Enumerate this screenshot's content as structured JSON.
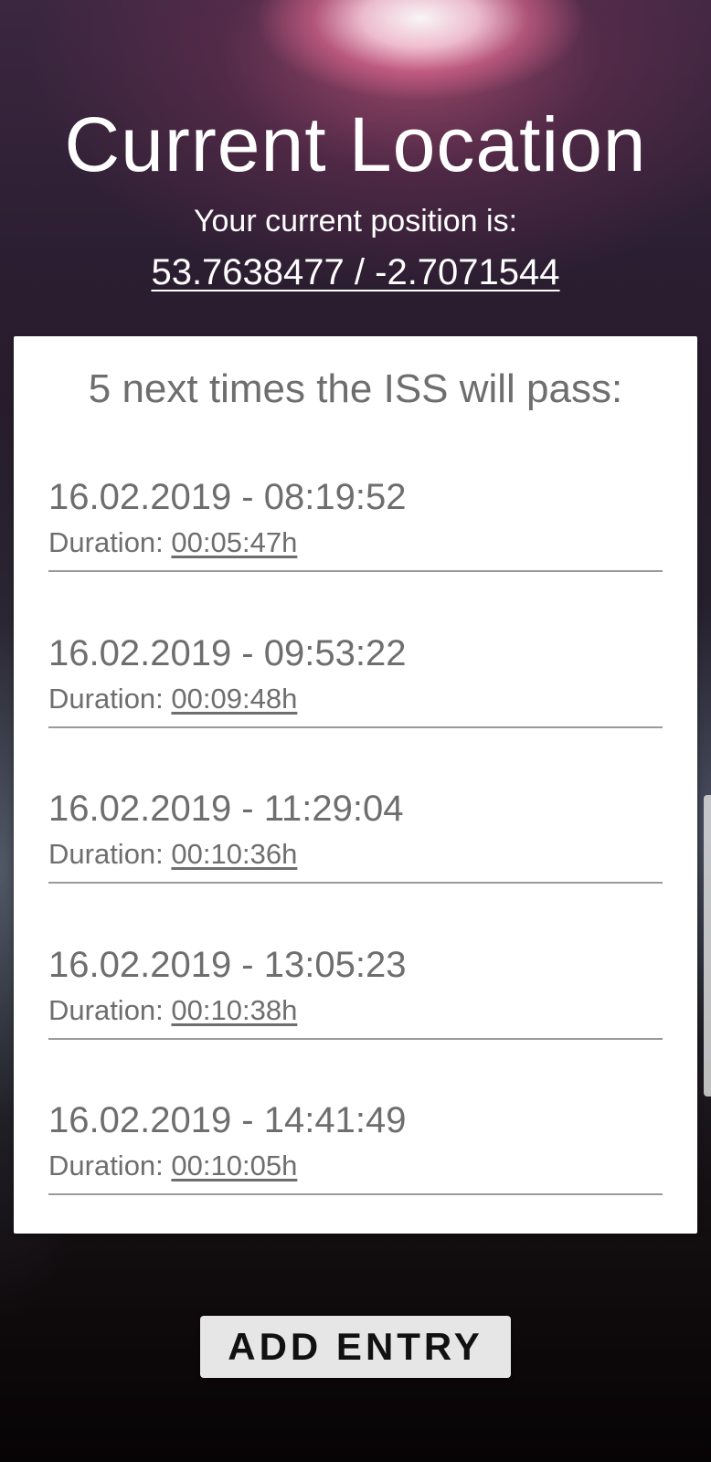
{
  "header": {
    "title": "Current Location",
    "subtitle": "Your current position is:",
    "coordinates": "53.7638477 / -2.7071544"
  },
  "passes": {
    "heading": "5 next times the ISS will pass:",
    "duration_label": "Duration:",
    "items": [
      {
        "datetime": "16.02.2019 - 08:19:52",
        "duration": "00:05:47h"
      },
      {
        "datetime": "16.02.2019 - 09:53:22",
        "duration": "00:09:48h"
      },
      {
        "datetime": "16.02.2019 - 11:29:04",
        "duration": "00:10:36h"
      },
      {
        "datetime": "16.02.2019 - 13:05:23",
        "duration": "00:10:38h"
      },
      {
        "datetime": "16.02.2019 - 14:41:49",
        "duration": "00:10:05h"
      }
    ]
  },
  "actions": {
    "add_entry_label": "ADD ENTRY"
  },
  "colors": {
    "card_background": "#ffffff",
    "text_gray": "#6e6e6e",
    "button_background": "#e6e6e6"
  }
}
